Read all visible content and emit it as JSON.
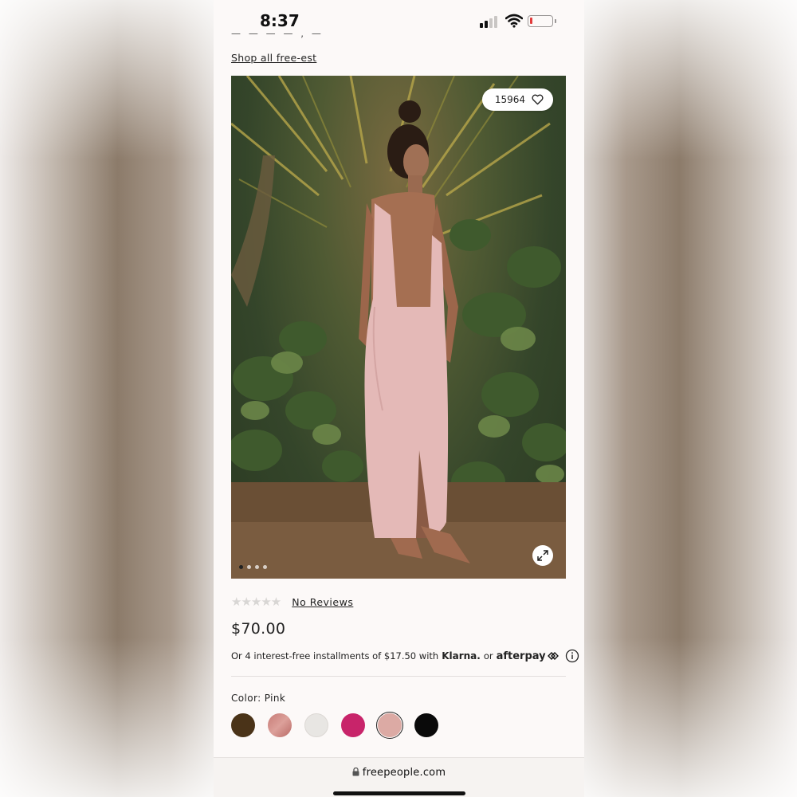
{
  "status_bar": {
    "time": "8:37",
    "battery_color": "#e23b3b"
  },
  "cutoff_heading": "— — —  —  ,  —",
  "shop_link": "Shop all free-est",
  "gallery": {
    "likes_count": "15964",
    "icons": [
      "heart-icon",
      "expand-icon"
    ],
    "dot_count": 4,
    "active_dot": 0
  },
  "rating": {
    "stars_filled": 0,
    "stars_total": 5,
    "stars": "★★★★★",
    "reviews_label": "No Reviews"
  },
  "price": "$70.00",
  "installments": {
    "text": "Or 4 interest-free installments of $17.50 with",
    "klarna": "Klarna.",
    "or": "or",
    "afterpay": "afterpay"
  },
  "color": {
    "label": "Color: Pink",
    "swatches": [
      {
        "name": "Brown",
        "hex": "#4a3318"
      },
      {
        "name": "Rose",
        "hex": "#c77b76"
      },
      {
        "name": "White",
        "hex": "#e8e6e3"
      },
      {
        "name": "Magenta",
        "hex": "#c8246a"
      },
      {
        "name": "Pink",
        "hex": "#dcaaa4",
        "selected": true
      },
      {
        "name": "Black",
        "hex": "#0a0a0a"
      }
    ]
  },
  "browser": {
    "url": "freepeople.com"
  }
}
